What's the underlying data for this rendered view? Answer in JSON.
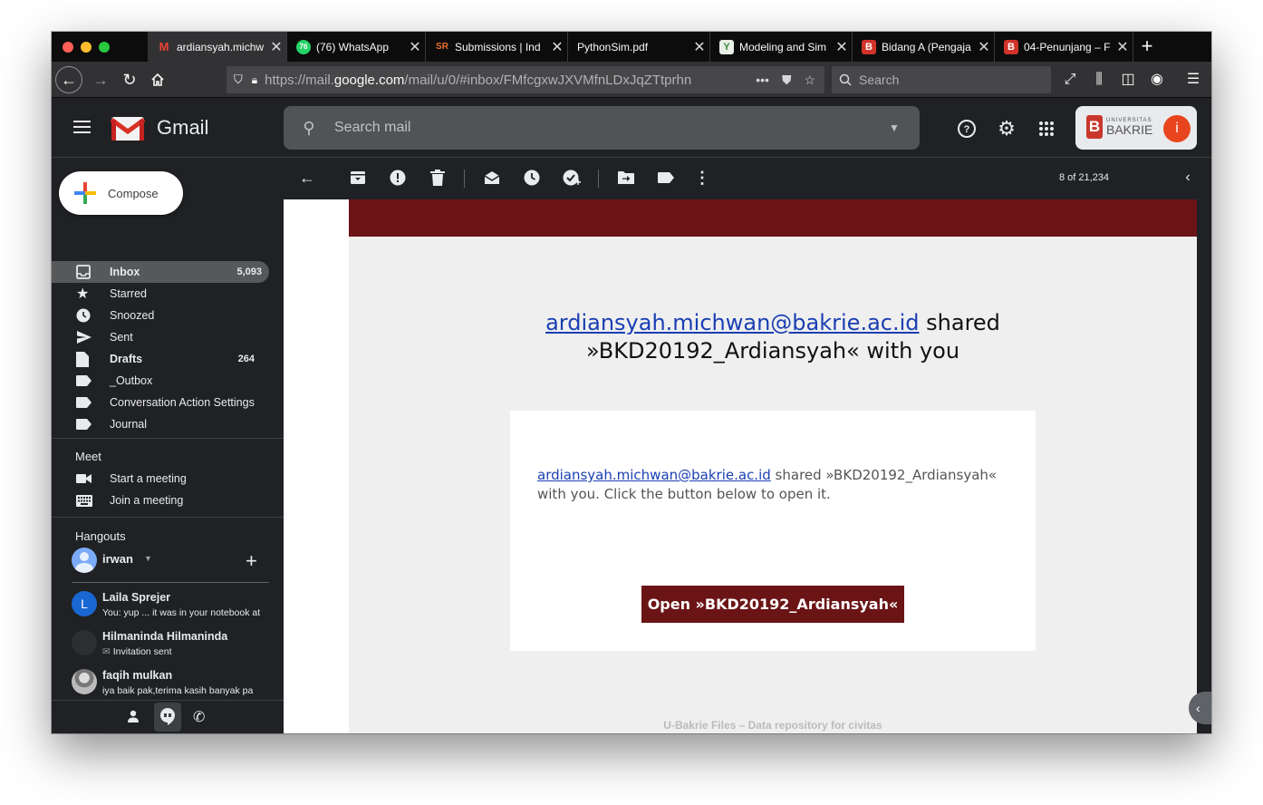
{
  "browser": {
    "tabs": [
      {
        "title": "ardiansyah.michw",
        "icon": "gmail-icon",
        "active": true
      },
      {
        "title": "(76) WhatsApp",
        "icon": "whatsapp-icon",
        "badge": "76"
      },
      {
        "title": "Submissions | Ind",
        "icon": "sr-icon"
      },
      {
        "title": "PythonSim.pdf",
        "icon": "pdf-icon"
      },
      {
        "title": "Modeling and Sim",
        "icon": "leaf-icon"
      },
      {
        "title": "Bidang A (Pengaja",
        "icon": "bakrie-icon"
      },
      {
        "title": "04-Penunjang – F",
        "icon": "bakrie-icon"
      }
    ],
    "url": "https://mail.google.com/mail/u/0/#inbox/FMfcgxwJXVMfnLDxJqZTtprhn",
    "url_host_prefix": "https://mail.",
    "url_host": "google.com",
    "url_path": "/mail/u/0/#inbox/FMfcgxwJXVMfnLDxJqZTtprhn",
    "search_placeholder": "Search",
    "more": "•••"
  },
  "gmail": {
    "brand": "Gmail",
    "search_placeholder": "Search mail",
    "account_logo_small": "UNIVERSITAS",
    "account_logo_big": "BAKRIE",
    "avatar_letter": "i"
  },
  "sidebar": {
    "compose": "Compose",
    "items": [
      {
        "label": "Inbox",
        "count": "5,093"
      },
      {
        "label": "Starred",
        "count": ""
      },
      {
        "label": "Snoozed",
        "count": ""
      },
      {
        "label": "Sent",
        "count": ""
      },
      {
        "label": "Drafts",
        "count": "264"
      },
      {
        "label": "_Outbox",
        "count": ""
      },
      {
        "label": "Conversation Action Settings",
        "count": ""
      },
      {
        "label": "Journal",
        "count": ""
      }
    ],
    "meet": {
      "title": "Meet",
      "start": "Start a meeting",
      "join": "Join a meeting"
    },
    "hangouts": {
      "title": "Hangouts",
      "user": "irwan",
      "contacts": [
        {
          "name": "Laila Sprejer",
          "message": "You: yup ... it was in your notebook at",
          "initial": "L"
        },
        {
          "name": "Hilmaninda Hilmaninda",
          "message": "Invitation sent",
          "initial": ""
        },
        {
          "name": "faqih mulkan",
          "message": "iya baik pak,terima kasih banyak pa",
          "initial": ""
        }
      ]
    }
  },
  "toolbar": {
    "pager": "8 of 21,234"
  },
  "email": {
    "sender_link": "ardiansyah.michwan@bakrie.ac.id",
    "headline_rest_1": " shared",
    "headline_line2": "»BKD20192_Ardiansyah« with you",
    "card_link": "ardiansyah.michwan@bakrie.ac.id",
    "card_text": " shared »BKD20192_Ardiansyah« with you. Click the button below to open it.",
    "button": "Open »BKD20192_Ardiansyah«",
    "footer": "U-Bakrie Files – Data repository for civitas"
  },
  "colors": {
    "accent": "#6b1416",
    "link": "#1a3fb3",
    "gmail_bg": "#202124"
  }
}
